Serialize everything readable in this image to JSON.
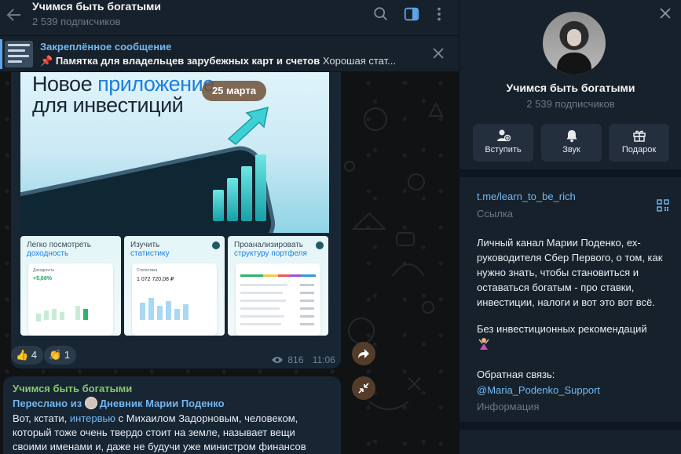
{
  "header": {
    "channel_title": "Учимся быть богатыми",
    "subscribers": "2 539 подписчиков"
  },
  "pinned": {
    "label": "Закреплённое сообщение",
    "emoji": "📌",
    "title": "Памятка для владельцев зарубежных карт и счетов",
    "preview": " Хорошая стат..."
  },
  "post1": {
    "hero_title_line1": "Новое ",
    "hero_title_highlight": "приложение",
    "hero_title_line2": "для инвестиций",
    "date_badge": "25 марта",
    "cards": [
      {
        "line1": "Легко посмотреть",
        "line2": "доходность"
      },
      {
        "line1": "Изучить",
        "line2": "статистику"
      },
      {
        "line1": "Проанализировать",
        "line2": "структуру портфеля"
      }
    ],
    "card1_value": "+5,66%",
    "card2_value": "1 072 720,08 ₽",
    "reactions": [
      {
        "emoji": "👍",
        "count": "4"
      },
      {
        "emoji": "👏",
        "count": "1"
      }
    ],
    "views": "816",
    "time": "11:06"
  },
  "post2": {
    "author": "Учимся быть богатыми",
    "forwarded_prefix": "Переслано из",
    "forwarded_from": "Дневник Марии Поденко",
    "text_a": "Вот, кстати, ",
    "text_link": "интервью",
    "text_b": " с Михаилом Задорновым, человеком,",
    "line2": "который тоже очень твердо стоит на земле, называет вещи",
    "line3": "своими именами и, даже не будучи уже министром финансов"
  },
  "info_panel": {
    "name": "Учимся быть богатыми",
    "subscribers": "2 539 подписчиков",
    "actions": [
      {
        "label": "Вступить",
        "icon": "add-user-icon"
      },
      {
        "label": "Звук",
        "icon": "bell-icon"
      },
      {
        "label": "Подарок",
        "icon": "gift-icon"
      }
    ],
    "link": "t.me/learn_to_be_rich",
    "link_label": "Ссылка",
    "description": "Личный канал Марии Поденко, ех-руководителя Сбер Первого, о том, как нужно знать, чтобы становиться и оставаться богатым - про ставки, инвестиции, налоги и вот это вот всё.",
    "no_advice": "Без инвестиционных рекомендаций",
    "feedback_label": "Обратная связь:",
    "feedback_link": "@Maria_Podenko_Support",
    "feedback_info": "Информация"
  },
  "colors": {
    "accent": "#71baf5",
    "author_green": "#85c96e",
    "bubble": "#182533",
    "panel": "#17212b"
  }
}
